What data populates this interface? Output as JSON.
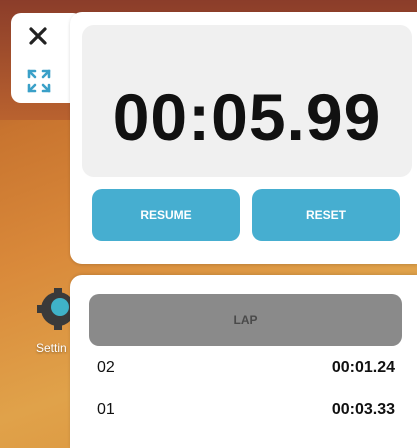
{
  "timer": {
    "display": "00:05.99",
    "resume_label": "RESUME",
    "reset_label": "RESET"
  },
  "laps": {
    "lap_label": "LAP",
    "rows": [
      {
        "index": "02",
        "time": "00:01.24"
      },
      {
        "index": "01",
        "time": "00:03.33"
      }
    ]
  },
  "desktop": {
    "settings_label": "Settin"
  },
  "colors": {
    "accent_button": "#46aed0",
    "lap_button": "#8a8a8a",
    "display_bg": "#f0f0f0"
  },
  "icons": {
    "close": "close-icon",
    "expand": "expand-icon",
    "settings": "settings-gear-icon"
  }
}
